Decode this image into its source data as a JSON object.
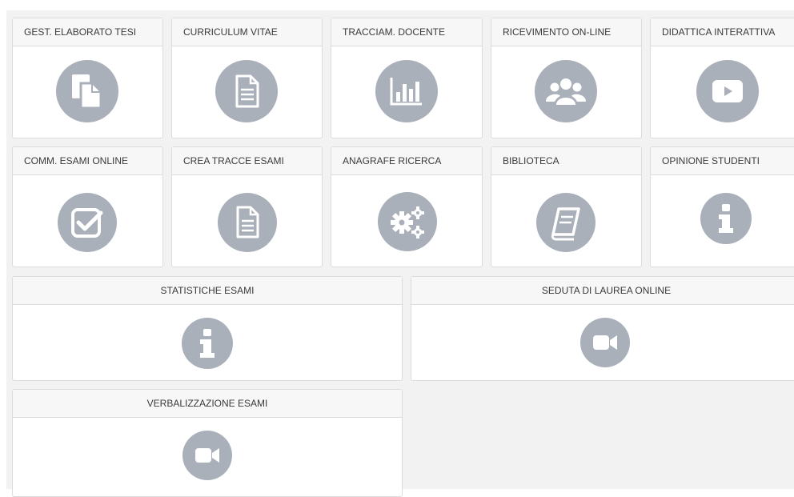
{
  "tiles": {
    "gest_elaborato_tesi": {
      "label": "GEST. ELABORATO TESI",
      "icon": "documents-icon"
    },
    "curriculum_vitae": {
      "label": "CURRICULUM VITAE",
      "icon": "document-icon"
    },
    "tracciam_docente": {
      "label": "TRACCIAM. DOCENTE",
      "icon": "bar-chart-icon"
    },
    "ricevimento_online": {
      "label": "RICEVIMENTO ON-LINE",
      "icon": "users-group-icon"
    },
    "didattica_interattiva": {
      "label": "DIDATTICA INTERATTIVA",
      "icon": "video-play-icon"
    },
    "comm_esami_online": {
      "label": "COMM. ESAMI ONLINE",
      "icon": "checkbox-icon"
    },
    "crea_tracce_esami": {
      "label": "CREA TRACCE ESAMI",
      "icon": "document-icon"
    },
    "anagrafe_ricerca": {
      "label": "ANAGRAFE RICERCA",
      "icon": "gears-icon"
    },
    "biblioteca": {
      "label": "BIBLIOTECA",
      "icon": "book-icon"
    },
    "opinione_studenti": {
      "label": "OPINIONE STUDENTI",
      "icon": "info-icon"
    },
    "statistiche_esami": {
      "label": "STATISTICHE ESAMI",
      "icon": "info-icon"
    },
    "seduta_di_laurea_online": {
      "label": "SEDUTA DI LAUREA ONLINE",
      "icon": "video-camera-icon"
    },
    "verbalizzazione_esami": {
      "label": "VERBALIZZAZIONE ESAMI",
      "icon": "video-camera-icon"
    }
  },
  "colors": {
    "page_background": "#f2f2f2",
    "tile_background": "#ffffff",
    "tile_header_background": "#f7f7f7",
    "tile_border": "#dcdcdc",
    "icon_circle": "#a9b0b9",
    "icon_glyph": "#ffffff",
    "label_text": "#3a3a3a"
  }
}
